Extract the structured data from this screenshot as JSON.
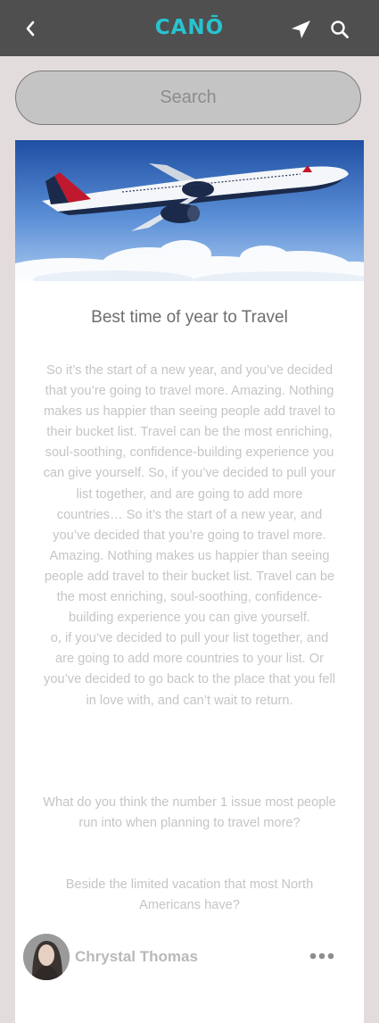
{
  "header": {
    "brand": "CANŌ",
    "back_icon": "chevron-left-icon",
    "location_icon": "navigation-arrow-icon",
    "search_icon": "search-icon",
    "background": "#4f4f4f",
    "brand_color": "#27c3cf"
  },
  "search": {
    "placeholder": "Search"
  },
  "article": {
    "image": "delta-airplane-above-clouds",
    "title": "Best time of year to Travel",
    "body": "So it’s the start of a new year, and you’ve decided that you’re going to travel more. Amazing. Nothing makes us happier than seeing people add travel to their bucket list. Travel can be the most enriching, soul-soothing, confidence-building experience you can give yourself. So, if you’ve decided to pull your list together, and are going to add more countries… So it’s the start of a new year, and you’ve decided that you’re going to travel more. Amazing. Nothing makes us happier than seeing people add travel to their bucket list. Travel can be the most enriching, soul-soothing, confidence-building experience you can give yourself.\no, if you’ve decided to pull your list together, and are going to add more countries to your list. Or you’ve decided to go back to the place that you fell in love with, and can’t wait to return.",
    "question": "What do you think the number 1 issue most people run into when planning to travel more?",
    "question2": "Beside the limited vacation that most North Americans have?",
    "author": {
      "name": "Chrystal Thomas",
      "avatar": "author-avatar",
      "more_icon": "more-dots-icon"
    }
  }
}
